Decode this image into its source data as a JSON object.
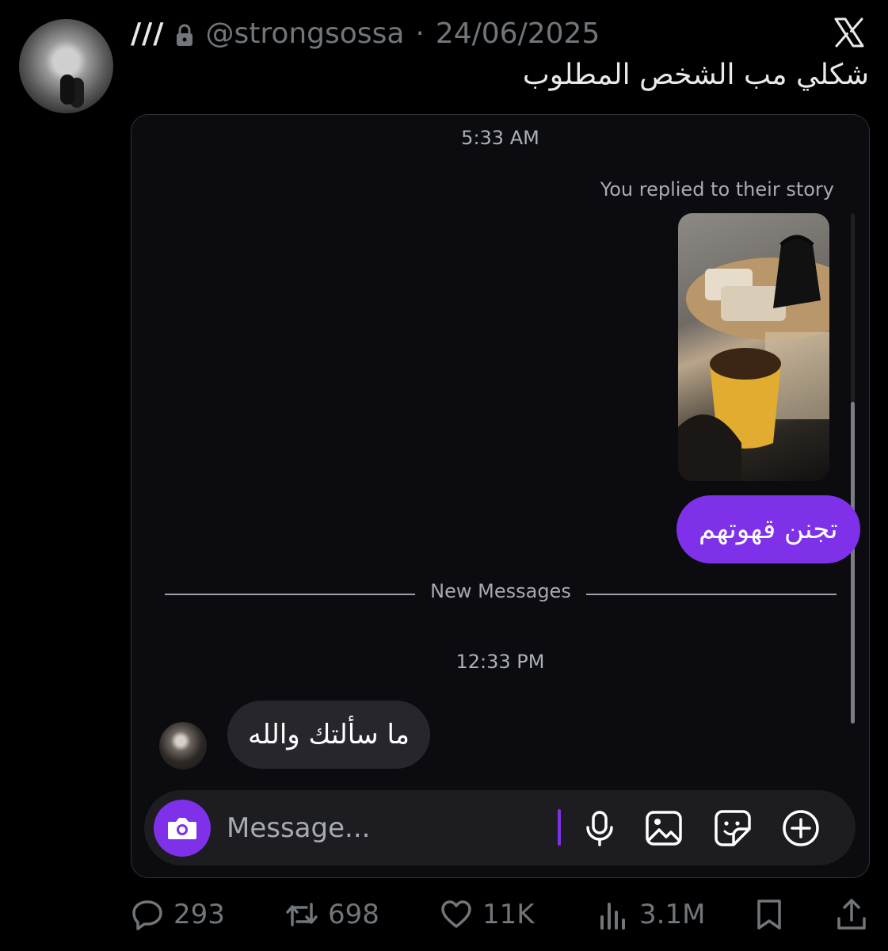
{
  "tweet": {
    "display_name": "///",
    "handle": "@strongsossa",
    "separator": "·",
    "date": "24/06/2025",
    "text": "شكلي مب الشخص المطلوب"
  },
  "chat": {
    "time_top": "5:33 AM",
    "replied_label": "You replied to their story",
    "my_message": "تجنن قهوتهم",
    "divider_label": "New Messages",
    "time_bottom": "12:33 PM",
    "their_message": "ما سألتك والله",
    "composer_placeholder": "Message..."
  },
  "actions": {
    "replies": "293",
    "retweets": "698",
    "likes": "11K",
    "views": "3.1M"
  },
  "colors": {
    "accent_purple": "#7e31e9",
    "background": "#000000",
    "card_bg": "#0b0b10",
    "muted_text": "#71767b"
  },
  "icons": [
    "lock-icon",
    "x-logo-icon",
    "camera-icon",
    "microphone-icon",
    "image-icon",
    "sticker-icon",
    "plus-circle-icon",
    "reply-icon",
    "retweet-icon",
    "like-icon",
    "views-icon",
    "bookmark-icon",
    "share-icon"
  ]
}
